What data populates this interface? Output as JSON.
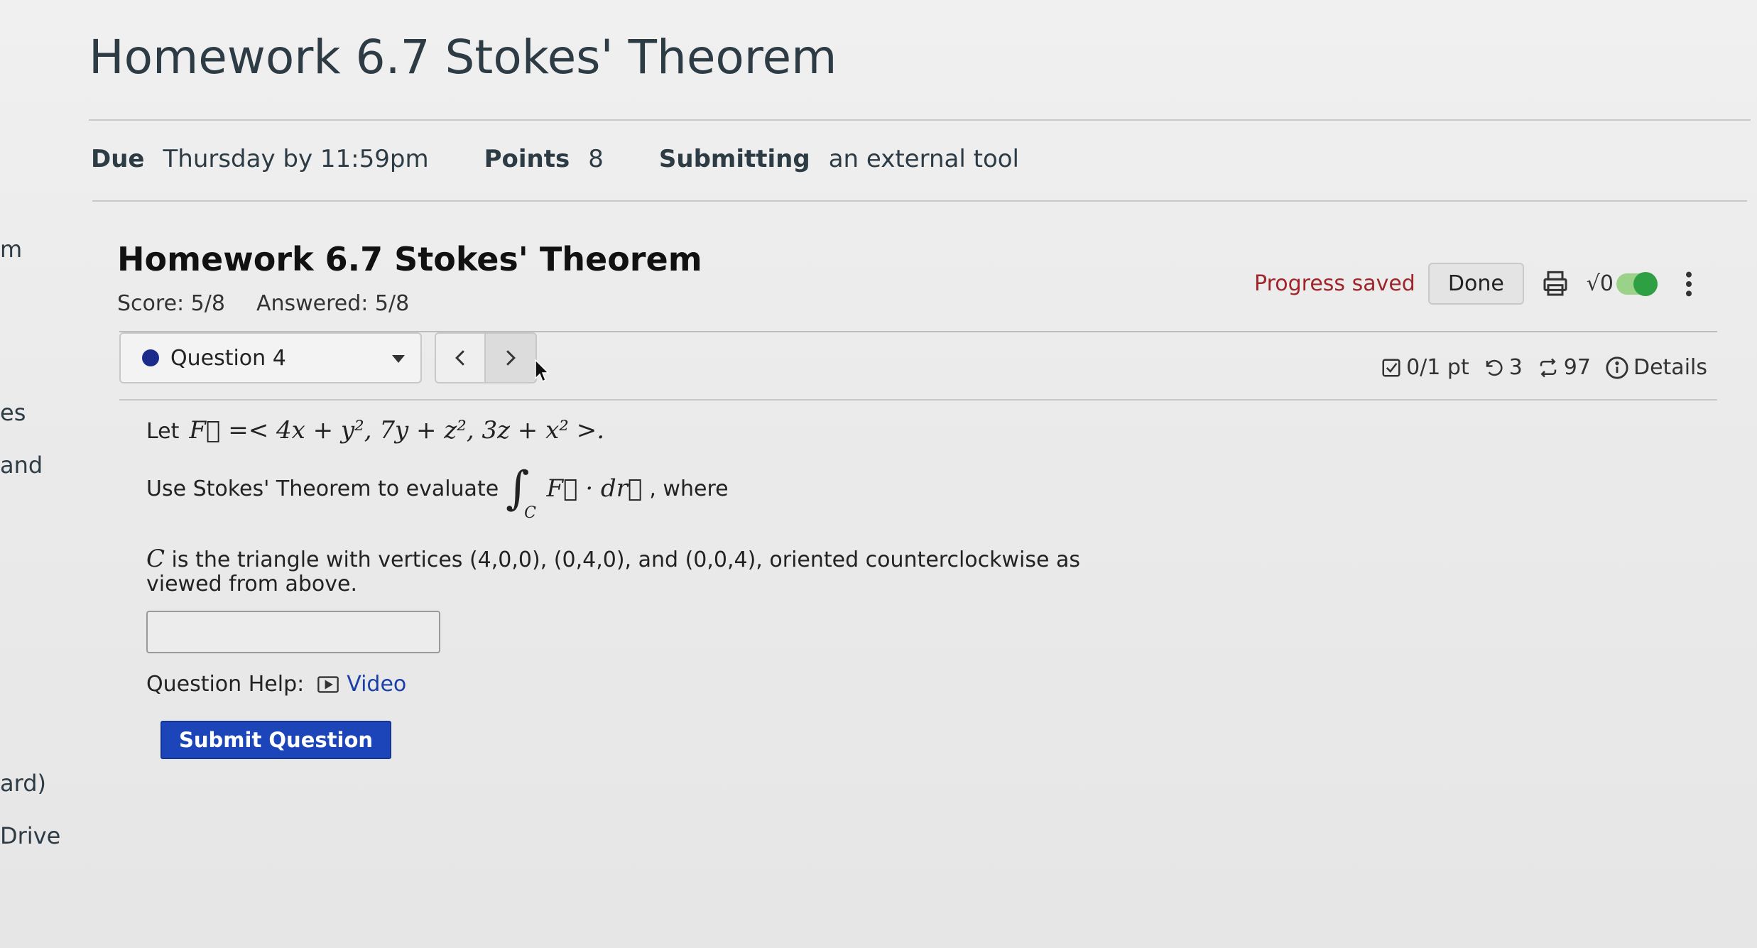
{
  "sidenav": {
    "fragments": [
      "m",
      "es",
      "and",
      "ard)",
      "Drive"
    ]
  },
  "page": {
    "title": "Homework 6.7 Stokes' Theorem",
    "due_label": "Due",
    "due_value": "Thursday by 11:59pm",
    "points_label": "Points",
    "points_value": "8",
    "submitting_label": "Submitting",
    "submitting_value": "an external tool"
  },
  "homework": {
    "title": "Homework 6.7 Stokes' Theorem",
    "score": "Score: 5/8",
    "answered": "Answered: 5/8",
    "progress_status": "Progress saved",
    "done_label": "Done",
    "sqrt_label": "√0",
    "toggle_on": true
  },
  "question_nav": {
    "selected": "Question 4",
    "prev_icon": "chevron-left-icon",
    "next_icon": "chevron-right-icon",
    "points": "0/1 pt",
    "retries": "3",
    "attempts": "97",
    "details_label": "Details"
  },
  "question": {
    "let": "Let",
    "field_math": "F⃗ =< 4x + y², 7y + z², 3z + x² >.",
    "evaluate_text": "Use Stokes' Theorem to evaluate",
    "integral_symbol": "∫",
    "integral_sub": "C",
    "integrand": "F⃗ · dr⃗",
    "where": ", where",
    "curve_var": "C",
    "description": " is the triangle with vertices (4,0,0), (0,4,0), and (0,0,4), oriented counterclockwise as viewed from above.",
    "answer_value": "",
    "help_label": "Question Help:",
    "video_label": "Video",
    "submit_label": "Submit Question"
  },
  "colors": {
    "accent": "#1b45b8",
    "progress": "#a0252a",
    "toggle": "#2ea043"
  }
}
